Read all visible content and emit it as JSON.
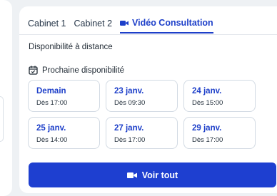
{
  "colors": {
    "accent": "#1d3fc9",
    "button": "#1e3fd0",
    "background": "#eef1f4",
    "slot_border": "#d2dae3"
  },
  "tabs": [
    {
      "label": "Cabinet 1",
      "active": false
    },
    {
      "label": "Cabinet 2",
      "active": false
    },
    {
      "label": "Vidéo Consultation",
      "active": true,
      "icon": "video-camera-icon"
    }
  ],
  "section_title": "Disponibilité à distance",
  "next_availability": {
    "icon": "calendar-check-icon",
    "label": "Prochaine disponibilité"
  },
  "slots": [
    {
      "day": "Demain",
      "time": "Dès 17:00"
    },
    {
      "day": "23 janv.",
      "time": "Dès 09:30"
    },
    {
      "day": "24 janv.",
      "time": "Dès 15:00"
    },
    {
      "day": "25 janv.",
      "time": "Dès 14:00"
    },
    {
      "day": "27 janv.",
      "time": "Dès 17:00"
    },
    {
      "day": "29 janv.",
      "time": "Dès 17:00"
    }
  ],
  "cta": {
    "icon": "video-camera-icon",
    "label": "Voir tout"
  }
}
